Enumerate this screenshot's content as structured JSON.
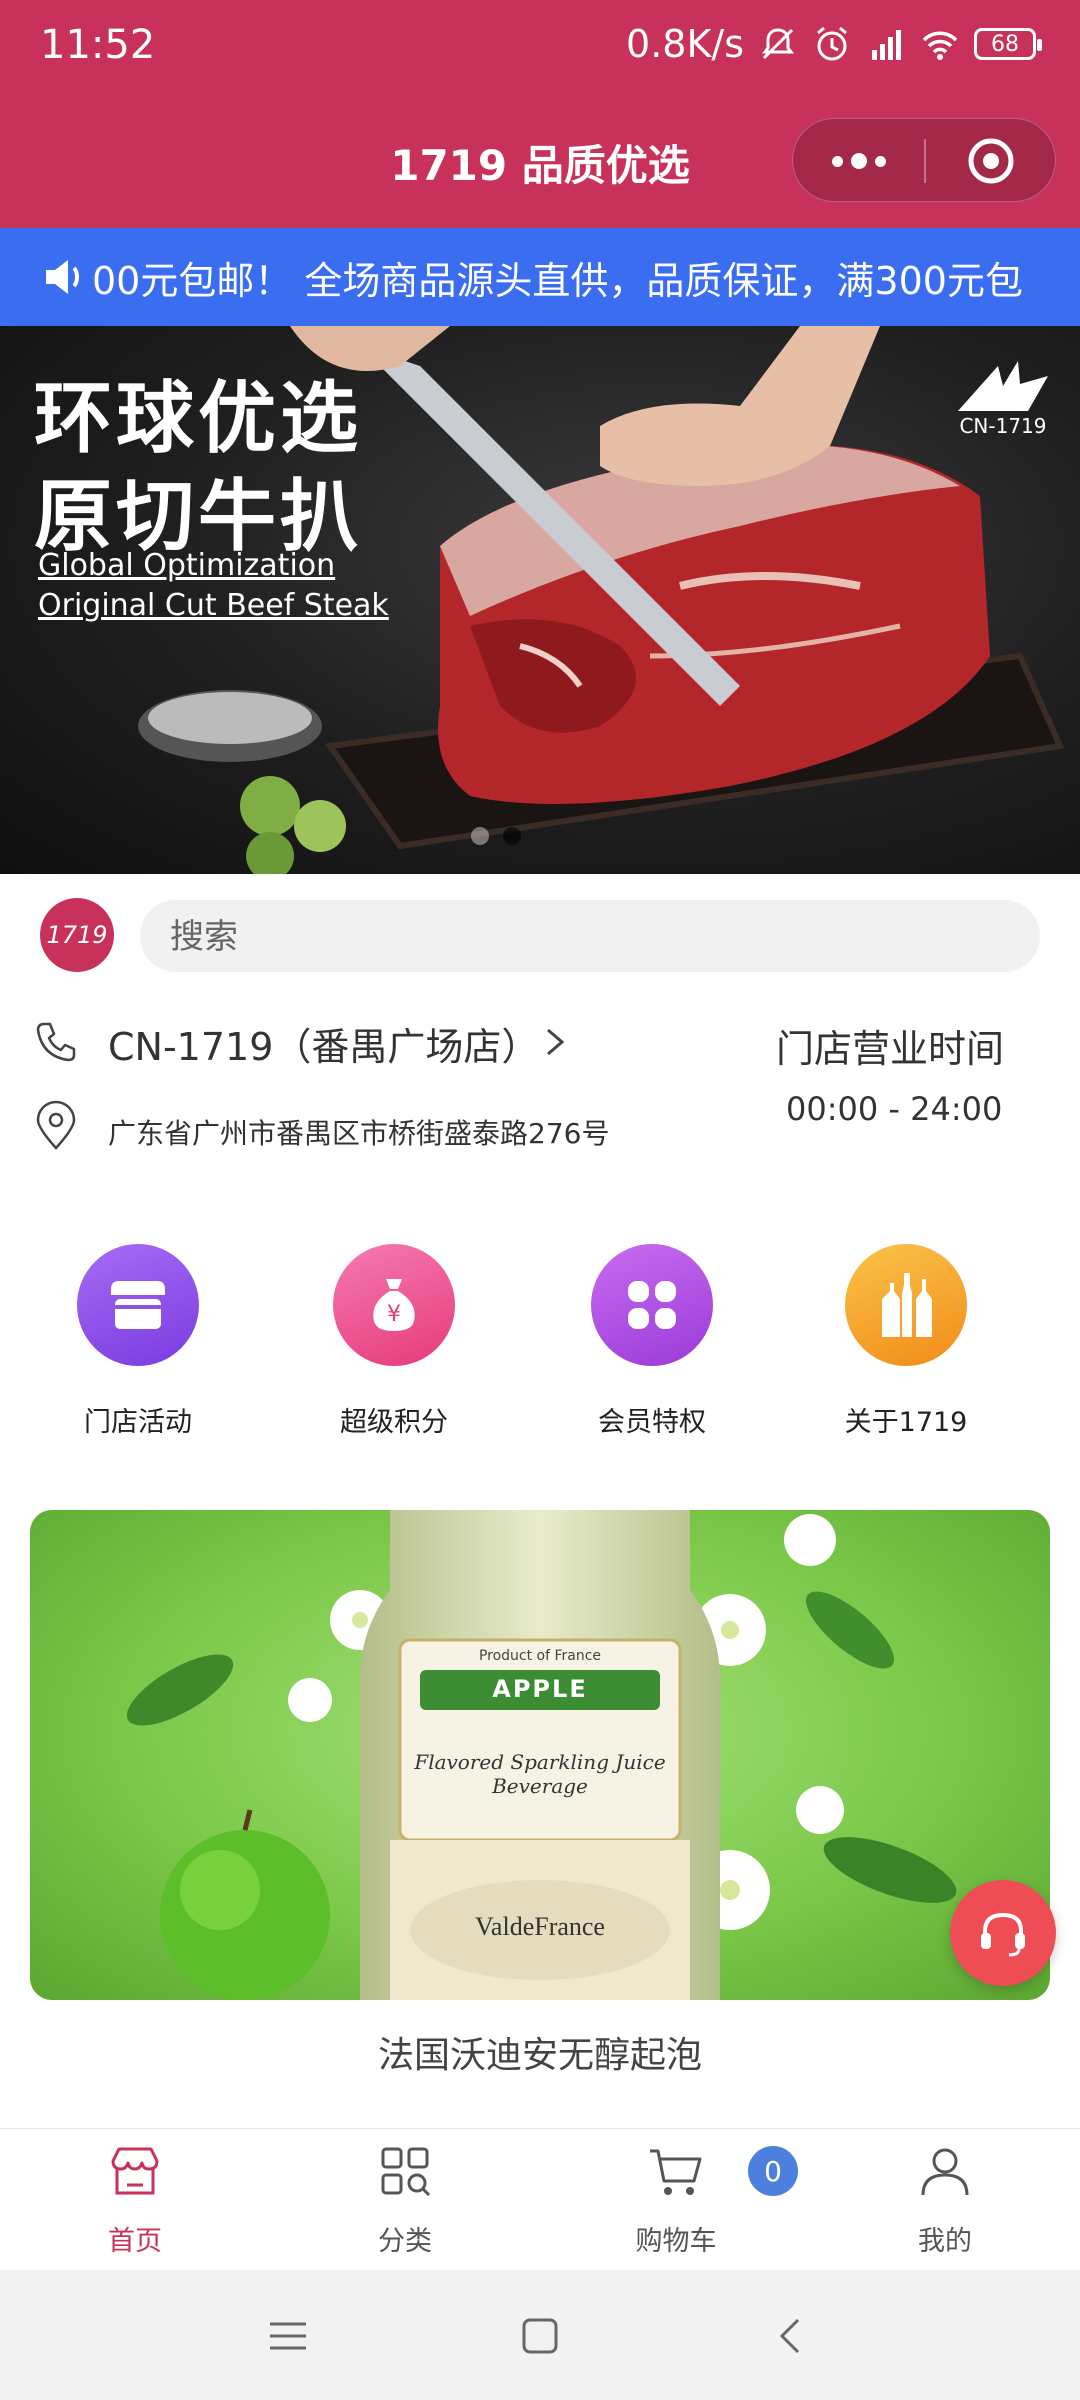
{
  "status_bar": {
    "time": "11:52",
    "network_speed": "0.8K/s",
    "battery": "68"
  },
  "title_bar": {
    "title": "1719 品质优选"
  },
  "notice": {
    "text": "00元包邮！ 全场商品源头直供，品质保证，满300元包"
  },
  "hero_banner": {
    "title_line1": "环球优选",
    "title_line2": "原切牛扒",
    "subtitle_line1": "Global Optimization",
    "subtitle_line2": "Original Cut Beef Steak",
    "logo_text": "CN-1719"
  },
  "store": {
    "logo_text": "1719",
    "search_placeholder": "搜索",
    "name": "CN-1719（番禺广场店）",
    "address": "广东省广州市番禺区市桥街盛泰路276号",
    "hours_label": "门店营业时间",
    "hours_value": "00:00 - 24:00"
  },
  "quick_menu": [
    {
      "label": "门店活动",
      "icon": "store-icon",
      "color": "#8e4be6"
    },
    {
      "label": "超级积分",
      "icon": "money-bag-icon",
      "color": "#ec4a8c"
    },
    {
      "label": "会员特权",
      "icon": "grid-icon",
      "color": "#b04ae0"
    },
    {
      "label": "关于1719",
      "icon": "bottles-icon",
      "color": "#f5a623"
    }
  ],
  "promo": {
    "caption": "法国沃迪安无醇起泡",
    "label_top": "Product of France",
    "label_brand": "APPLE",
    "label_desc": "Flavored Sparkling Juice Beverage",
    "label_maker": "ValdeFrance"
  },
  "tab_bar": {
    "items": [
      {
        "label": "首页",
        "icon": "home-store-icon",
        "active": true
      },
      {
        "label": "分类",
        "icon": "category-icon",
        "active": false
      },
      {
        "label": "购物车",
        "icon": "cart-icon",
        "active": false
      },
      {
        "label": "我的",
        "icon": "user-icon",
        "active": false
      }
    ],
    "cart_count": "0"
  },
  "colors": {
    "brand": "#c8325a",
    "notice_bg": "#3a6df0",
    "support": "#ee4d55"
  }
}
